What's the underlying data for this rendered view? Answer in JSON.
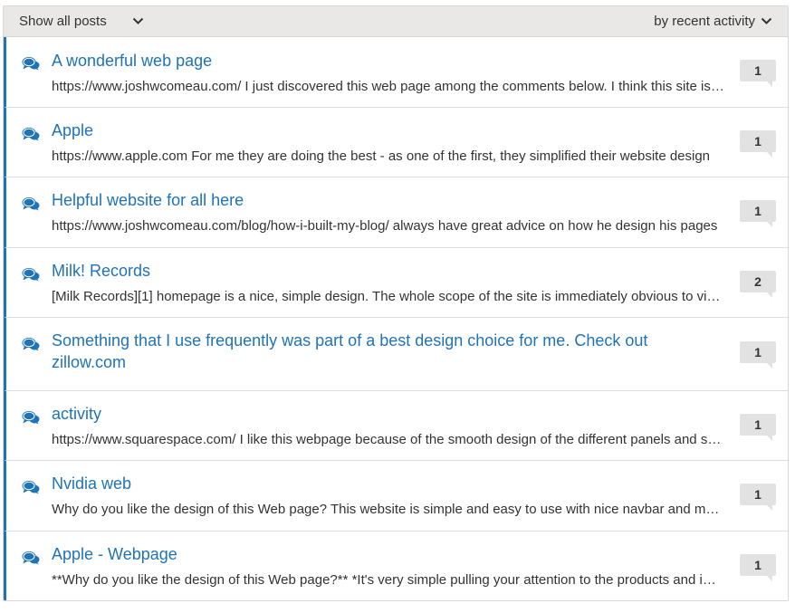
{
  "toolbar": {
    "filter_label": "Show all posts",
    "sort_label": "by recent activity"
  },
  "colors": {
    "accent": "#1f73b7",
    "badge_bg": "#e2e2e2",
    "toolbar_bg": "#e9e8e6"
  },
  "posts": [
    {
      "icon": "comments-icon",
      "title": "A wonderful web page",
      "excerpt": "https://www.joshwcomeau.com/ I just discovered this web page among the comments below. I think this site is really good looking",
      "count": "1"
    },
    {
      "icon": "comments-icon",
      "title": "Apple",
      "excerpt": "https://www.apple.com For me they are doing the best - as one of the first, they simplified their website design",
      "count": "1"
    },
    {
      "icon": "comments-icon",
      "title": "Helpful website for all here",
      "excerpt": "https://www.joshwcomeau.com/blog/how-i-built-my-blog/ always have great advice on how he design his pages",
      "count": "1"
    },
    {
      "icon": "comments-icon",
      "title": "Milk! Records",
      "excerpt": "[Milk Records][1] homepage is a nice, simple design. The whole scope of the site is immediately obvious to visitors",
      "count": "2"
    },
    {
      "icon": "comments-icon",
      "title": "Something that I use frequently was part of a best design choice for me. Check out zillow.com",
      "excerpt": "",
      "count": "1"
    },
    {
      "icon": "comments-icon",
      "title": "activity",
      "excerpt": "https://www.squarespace.com/ I like this webpage because of the smooth design of the different panels and sections",
      "count": "1"
    },
    {
      "icon": "comments-icon",
      "title": "Nvidia web",
      "excerpt": "Why do you like the design of this Web page? This website is simple and easy to use with nice navbar and menus",
      "count": "1"
    },
    {
      "icon": "comments-icon",
      "title": "Apple - Webpage",
      "excerpt": "**Why do you like the design of this Web page?** *It's very simple pulling your attention to the products and images",
      "count": "1"
    }
  ]
}
